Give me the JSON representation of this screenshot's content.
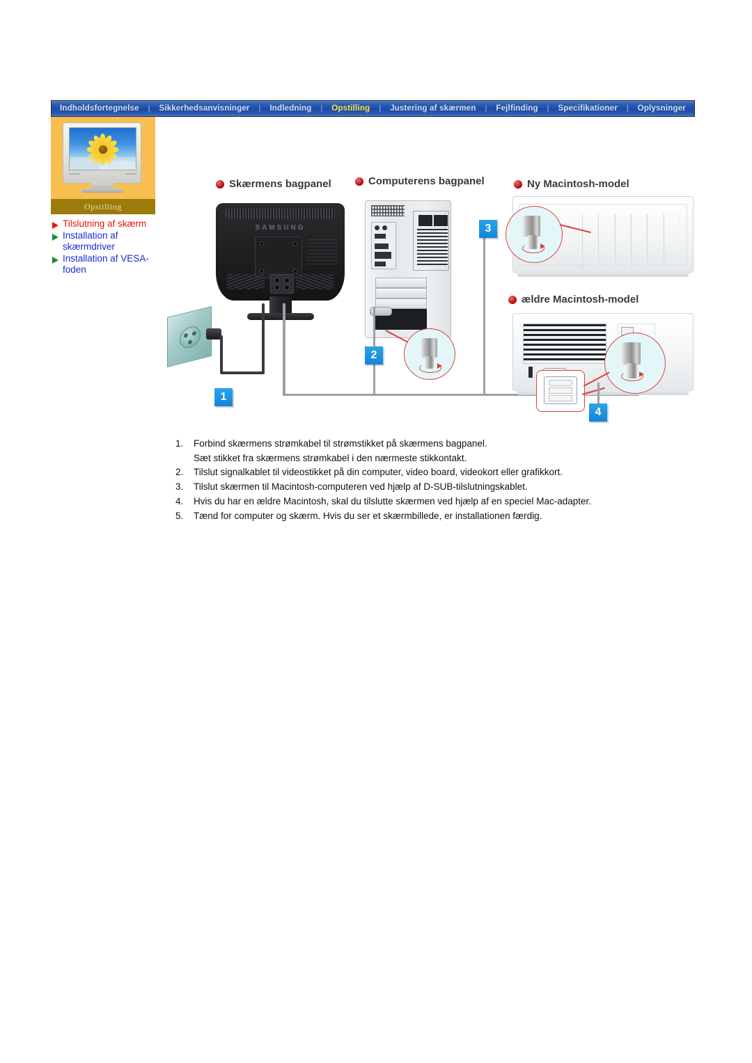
{
  "nav": {
    "items": [
      {
        "label": "Indholdsfortegnelse",
        "active": false
      },
      {
        "label": "Sikkerhedsanvisninger",
        "active": false
      },
      {
        "label": "Indledning",
        "active": false
      },
      {
        "label": "Opstilling",
        "active": true
      },
      {
        "label": "Justering af skærmen",
        "active": false
      },
      {
        "label": "Fejlfinding",
        "active": false
      },
      {
        "label": "Specifikationer",
        "active": false
      },
      {
        "label": "Oplysninger",
        "active": false
      }
    ],
    "separator": "|",
    "active_color": "#ffe94d",
    "bar_color": "#1d4aa8"
  },
  "sidebar": {
    "banner_label": "Opstilling",
    "thumb_bg": "#f7bf50",
    "banner_bg": "#9c7b0b",
    "items": [
      {
        "label": "Tilslutning af skærm",
        "current": true,
        "bullet_color": "#e8120c"
      },
      {
        "label": "Installation af skærmdriver",
        "current": false,
        "bullet_color": "#1f8a2a"
      },
      {
        "label": "Installation af VESA-foden",
        "current": false,
        "bullet_color": "#1f8a2a"
      }
    ]
  },
  "diagram": {
    "headings": [
      {
        "label": "Skærmens bagpanel"
      },
      {
        "label": "Computerens bagpanel"
      },
      {
        "label": "Ny Macintosh-model"
      },
      {
        "label": "ældre Macintosh-model"
      }
    ],
    "monitor_brand": "SAMSUNG",
    "badges": [
      "1",
      "2",
      "3",
      "4"
    ],
    "badge_color": "#1386d8",
    "callout_color": "#e0403a"
  },
  "instructions": [
    {
      "num": "1.",
      "text": "Forbind skærmens strømkabel til strømstikket på skærmens bagpanel.",
      "sub": "Sæt stikket fra skærmens strømkabel i den nærmeste stikkontakt."
    },
    {
      "num": "2.",
      "text": "Tilslut signalkablet til videostikket på din computer, video board, videokort eller grafikkort.",
      "sub": ""
    },
    {
      "num": "3.",
      "text": "Tilslut skærmen til Macintosh-computeren ved hjælp af D-SUB-tilslutningskablet.",
      "sub": ""
    },
    {
      "num": "4.",
      "text": "Hvis du har en ældre Macintosh, skal du tilslutte skærmen ved hjælp af en speciel Mac-adapter.",
      "sub": ""
    },
    {
      "num": "5.",
      "text": "Tænd for computer og skærm. Hvis du ser et skærmbillede, er installationen færdig.",
      "sub": ""
    }
  ]
}
